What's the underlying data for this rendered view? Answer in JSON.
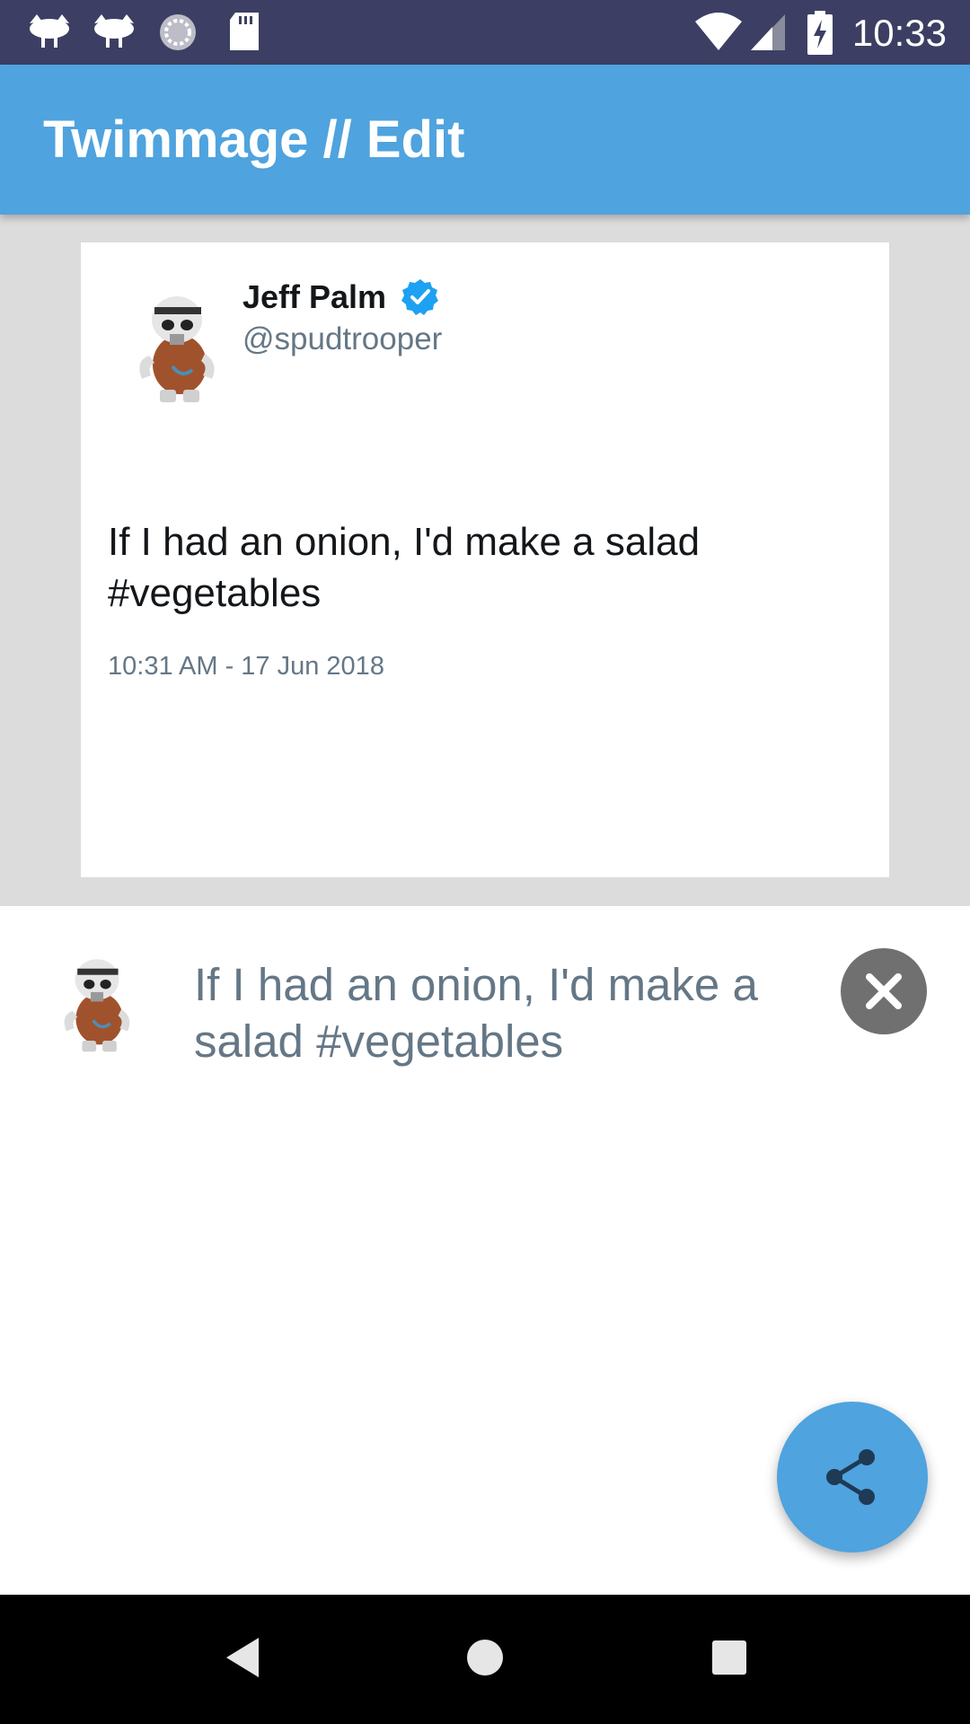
{
  "status_bar": {
    "time": "10:33",
    "icons": [
      "bird-notification-icon",
      "bird-notification-icon",
      "sync-icon",
      "sd-card-icon",
      "wifi-icon",
      "signal-icon",
      "battery-charging-icon"
    ]
  },
  "app_bar": {
    "title": "Twimmage // Edit"
  },
  "tweet_card": {
    "name": "Jeff Palm",
    "handle": "@spudtrooper",
    "text": "If I had an onion, I'd make a salad #vegetables",
    "timestamp": "10:31 AM - 17 Jun 2018",
    "verified_icon": "verified-badge-icon"
  },
  "editor": {
    "text": "If I had an onion, I'd make a salad #vegetables",
    "clear_icon": "close-icon"
  },
  "fab": {
    "icon": "share-icon"
  },
  "nav_bar": {
    "icons": [
      "back-icon",
      "home-icon",
      "recents-icon"
    ]
  },
  "colors": {
    "status_bar": "#3c3f63",
    "app_bar": "#4fa3de",
    "preview_bg": "#dcdcdc",
    "fab": "#4fa3de",
    "clear_button": "#707070",
    "secondary_text": "#657786",
    "verified": "#1da1f2"
  }
}
